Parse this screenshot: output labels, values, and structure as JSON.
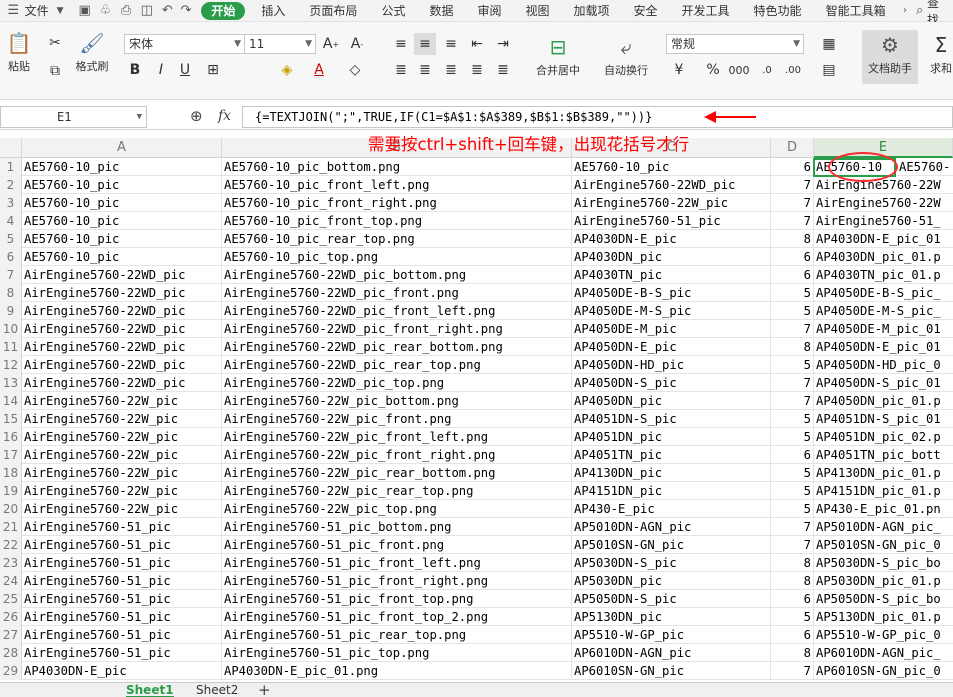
{
  "menu": {
    "file_label": "文件",
    "tabs": [
      "开始",
      "插入",
      "页面布局",
      "公式",
      "数据",
      "审阅",
      "视图",
      "加载项",
      "安全",
      "开发工具",
      "特色功能",
      "智能工具箱"
    ],
    "active_tab": "开始",
    "search_label": "查找"
  },
  "ribbon": {
    "paste_label": "粘贴",
    "format_painter_label": "格式刷",
    "font_name": "宋体",
    "font_size": "11",
    "merge_label": "合并居中",
    "wrap_label": "自动换行",
    "number_format": "常规",
    "doc_helper_label": "文档助手",
    "sum_label": "求和"
  },
  "formula_bar": {
    "name_box": "E1",
    "fx": "fx",
    "formula": "{=TEXTJOIN(\";\",TRUE,IF(C1=$A$1:$A$389,$B$1:$B$389,\"\"))}"
  },
  "annotation": "需要按ctrl+shift+回车键，出现花括号才行",
  "columns": [
    "A",
    "B",
    "C",
    "D",
    "E"
  ],
  "rows": [
    {
      "n": "1",
      "a": "AE5760-10_pic",
      "b": "AE5760-10_pic_bottom.png",
      "c": "AE5760-10_pic",
      "d": "6",
      "e": "AE5760-10",
      "f": "AE5760-"
    },
    {
      "n": "2",
      "a": "AE5760-10_pic",
      "b": "AE5760-10_pic_front_left.png",
      "c": "AirEngine5760-22WD_pic",
      "d": "7",
      "e": "AirEngine5760-22W"
    },
    {
      "n": "3",
      "a": "AE5760-10_pic",
      "b": "AE5760-10_pic_front_right.png",
      "c": "AirEngine5760-22W_pic",
      "d": "7",
      "e": "AirEngine5760-22W"
    },
    {
      "n": "4",
      "a": "AE5760-10_pic",
      "b": "AE5760-10_pic_front_top.png",
      "c": "AirEngine5760-51_pic",
      "d": "7",
      "e": "AirEngine5760-51_"
    },
    {
      "n": "5",
      "a": "AE5760-10_pic",
      "b": "AE5760-10_pic_rear_top.png",
      "c": "AP4030DN-E_pic",
      "d": "8",
      "e": "AP4030DN-E_pic_01"
    },
    {
      "n": "6",
      "a": "AE5760-10_pic",
      "b": "AE5760-10_pic_top.png",
      "c": "AP4030DN_pic",
      "d": "6",
      "e": "AP4030DN_pic_01.p"
    },
    {
      "n": "7",
      "a": "AirEngine5760-22WD_pic",
      "b": "AirEngine5760-22WD_pic_bottom.png",
      "c": "AP4030TN_pic",
      "d": "6",
      "e": "AP4030TN_pic_01.p"
    },
    {
      "n": "8",
      "a": "AirEngine5760-22WD_pic",
      "b": "AirEngine5760-22WD_pic_front.png",
      "c": "AP4050DE-B-S_pic",
      "d": "5",
      "e": "AP4050DE-B-S_pic_"
    },
    {
      "n": "9",
      "a": "AirEngine5760-22WD_pic",
      "b": "AirEngine5760-22WD_pic_front_left.png",
      "c": "AP4050DE-M-S_pic",
      "d": "5",
      "e": "AP4050DE-M-S_pic_"
    },
    {
      "n": "10",
      "a": "AirEngine5760-22WD_pic",
      "b": "AirEngine5760-22WD_pic_front_right.png",
      "c": "AP4050DE-M_pic",
      "d": "7",
      "e": "AP4050DE-M_pic_01"
    },
    {
      "n": "11",
      "a": "AirEngine5760-22WD_pic",
      "b": "AirEngine5760-22WD_pic_rear_bottom.png",
      "c": "AP4050DN-E_pic",
      "d": "8",
      "e": "AP4050DN-E_pic_01"
    },
    {
      "n": "12",
      "a": "AirEngine5760-22WD_pic",
      "b": "AirEngine5760-22WD_pic_rear_top.png",
      "c": "AP4050DN-HD_pic",
      "d": "5",
      "e": "AP4050DN-HD_pic_0"
    },
    {
      "n": "13",
      "a": "AirEngine5760-22WD_pic",
      "b": "AirEngine5760-22WD_pic_top.png",
      "c": "AP4050DN-S_pic",
      "d": "7",
      "e": "AP4050DN-S_pic_01"
    },
    {
      "n": "14",
      "a": "AirEngine5760-22W_pic",
      "b": "AirEngine5760-22W_pic_bottom.png",
      "c": "AP4050DN_pic",
      "d": "7",
      "e": "AP4050DN_pic_01.p"
    },
    {
      "n": "15",
      "a": "AirEngine5760-22W_pic",
      "b": "AirEngine5760-22W_pic_front.png",
      "c": "AP4051DN-S_pic",
      "d": "5",
      "e": "AP4051DN-S_pic_01"
    },
    {
      "n": "16",
      "a": "AirEngine5760-22W_pic",
      "b": "AirEngine5760-22W_pic_front_left.png",
      "c": "AP4051DN_pic",
      "d": "5",
      "e": "AP4051DN_pic_02.p"
    },
    {
      "n": "17",
      "a": "AirEngine5760-22W_pic",
      "b": "AirEngine5760-22W_pic_front_right.png",
      "c": "AP4051TN_pic",
      "d": "6",
      "e": "AP4051TN_pic_bott"
    },
    {
      "n": "18",
      "a": "AirEngine5760-22W_pic",
      "b": "AirEngine5760-22W_pic_rear_bottom.png",
      "c": "AP4130DN_pic",
      "d": "5",
      "e": "AP4130DN_pic_01.p"
    },
    {
      "n": "19",
      "a": "AirEngine5760-22W_pic",
      "b": "AirEngine5760-22W_pic_rear_top.png",
      "c": "AP4151DN_pic",
      "d": "5",
      "e": "AP4151DN_pic_01.p"
    },
    {
      "n": "20",
      "a": "AirEngine5760-22W_pic",
      "b": "AirEngine5760-22W_pic_top.png",
      "c": "AP430-E_pic",
      "d": "5",
      "e": "AP430-E_pic_01.pn"
    },
    {
      "n": "21",
      "a": "AirEngine5760-51_pic",
      "b": "AirEngine5760-51_pic_bottom.png",
      "c": "AP5010DN-AGN_pic",
      "d": "7",
      "e": "AP5010DN-AGN_pic_"
    },
    {
      "n": "22",
      "a": "AirEngine5760-51_pic",
      "b": "AirEngine5760-51_pic_front.png",
      "c": "AP5010SN-GN_pic",
      "d": "7",
      "e": "AP5010SN-GN_pic_0"
    },
    {
      "n": "23",
      "a": "AirEngine5760-51_pic",
      "b": "AirEngine5760-51_pic_front_left.png",
      "c": "AP5030DN-S_pic",
      "d": "8",
      "e": "AP5030DN-S_pic_bo"
    },
    {
      "n": "24",
      "a": "AirEngine5760-51_pic",
      "b": "AirEngine5760-51_pic_front_right.png",
      "c": "AP5030DN_pic",
      "d": "8",
      "e": "AP5030DN_pic_01.p"
    },
    {
      "n": "25",
      "a": "AirEngine5760-51_pic",
      "b": "AirEngine5760-51_pic_front_top.png",
      "c": "AP5050DN-S_pic",
      "d": "6",
      "e": "AP5050DN-S_pic_bo"
    },
    {
      "n": "26",
      "a": "AirEngine5760-51_pic",
      "b": "AirEngine5760-51_pic_front_top_2.png",
      "c": "AP5130DN_pic",
      "d": "5",
      "e": "AP5130DN_pic_01.p"
    },
    {
      "n": "27",
      "a": "AirEngine5760-51_pic",
      "b": "AirEngine5760-51_pic_rear_top.png",
      "c": "AP5510-W-GP_pic",
      "d": "6",
      "e": "AP5510-W-GP_pic_0"
    },
    {
      "n": "28",
      "a": "AirEngine5760-51_pic",
      "b": "AirEngine5760-51_pic_top.png",
      "c": "AP6010DN-AGN_pic",
      "d": "8",
      "e": "AP6010DN-AGN_pic_"
    },
    {
      "n": "29",
      "a": "AP4030DN-E_pic",
      "b": "AP4030DN-E_pic_01.png",
      "c": "AP6010SN-GN_pic",
      "d": "7",
      "e": "AP6010SN-GN_pic_0"
    }
  ],
  "sheets": [
    "Sheet1",
    "Sheet2"
  ],
  "active_sheet": "Sheet1",
  "colors": {
    "accent": "#2a9d4b",
    "annotation": "#ff0000"
  }
}
